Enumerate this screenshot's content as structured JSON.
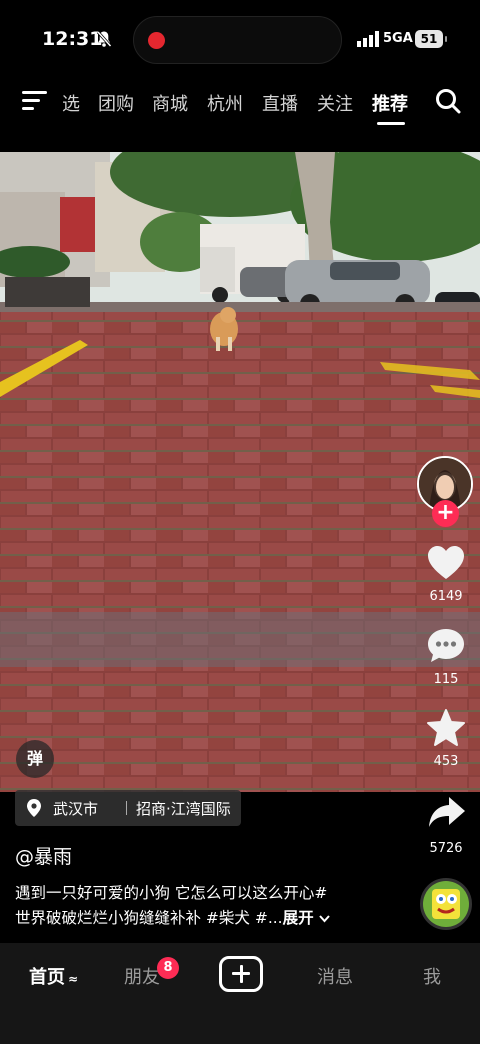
{
  "status_bar": {
    "time": "12:31",
    "network": "5GA",
    "battery": "51"
  },
  "top_nav": {
    "tabs": [
      "选",
      "团购",
      "商城",
      "杭州",
      "直播",
      "关注",
      "推荐"
    ],
    "active_tab": "推荐"
  },
  "video": {
    "danmu_label": "弹",
    "location": {
      "city": "武汉市",
      "place": "招商·江湾国际"
    }
  },
  "actions": {
    "likes": "6149",
    "comments": "115",
    "favorites": "453",
    "shares": "5726"
  },
  "post": {
    "author": "@暴雨",
    "caption_line1": "遇到一只好可爱的小狗 它怎么可以这么开心#",
    "caption_line2": "世界破破烂烂小狗缝缝补补  #柴犬 #...",
    "expand_label": "展开"
  },
  "bottom_bar": {
    "home": "首页",
    "friends": "朋友",
    "friends_badge": "8",
    "messages": "消息",
    "me": "我"
  },
  "colors": {
    "accent": "#fe2c55",
    "background": "#000000",
    "tabbar": "#161616"
  }
}
